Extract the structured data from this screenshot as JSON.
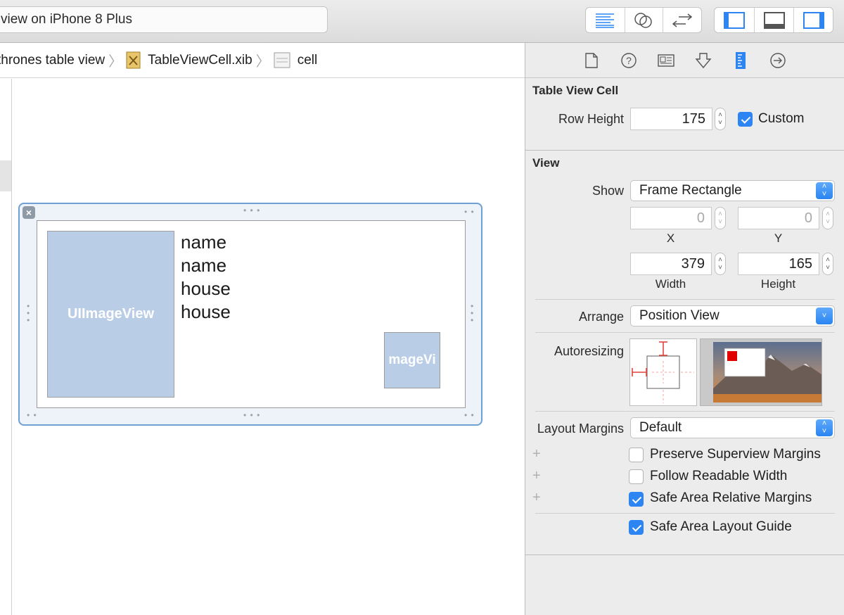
{
  "toolbar": {
    "scheme_text": "view on iPhone 8 Plus"
  },
  "breadcrumb": {
    "items": [
      "thrones table view",
      "TableViewCell.xib",
      "cell"
    ]
  },
  "canvas": {
    "image_view_big_label": "UIImageView",
    "image_view_small_label": "mageVi",
    "labels": [
      "name",
      "name",
      "house",
      "house"
    ]
  },
  "inspector": {
    "table_view_cell": {
      "title": "Table View Cell",
      "row_height_label": "Row Height",
      "row_height_value": "175",
      "custom_label": "Custom",
      "custom_checked": true
    },
    "view": {
      "title": "View",
      "show_label": "Show",
      "show_value": "Frame Rectangle",
      "x_value": "0",
      "y_value": "0",
      "x_label": "X",
      "y_label": "Y",
      "width_value": "379",
      "height_value": "165",
      "width_label": "Width",
      "height_label": "Height",
      "arrange_label": "Arrange",
      "arrange_value": "Position View",
      "autoresizing_label": "Autoresizing",
      "layout_margins_label": "Layout Margins",
      "layout_margins_value": "Default",
      "preserve_label": "Preserve Superview Margins",
      "follow_label": "Follow Readable Width",
      "safe_margins_label": "Safe Area Relative Margins",
      "safe_guide_label": "Safe Area Layout Guide",
      "plus_glyph": "+"
    }
  },
  "colors": {
    "accent": "#2c85f2",
    "cell_selection": "#6ea0d4",
    "image_placeholder": "#b9cde6",
    "autoresize_red": "#e0443a"
  }
}
